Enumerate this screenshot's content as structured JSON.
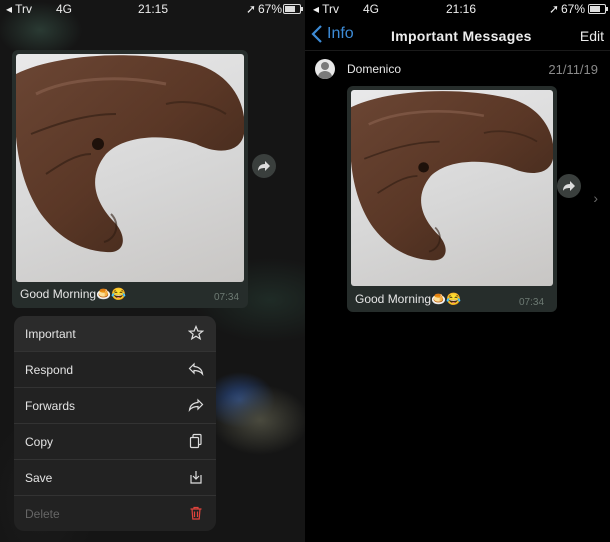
{
  "left": {
    "status": {
      "carrier": "Trv",
      "network": "4G",
      "time": "21:15",
      "battery": "67%"
    },
    "message": {
      "caption": "Good Morning",
      "emoji": "🍮😂",
      "time": "07:34"
    },
    "menu": [
      {
        "label": "Important",
        "icon": "star-icon"
      },
      {
        "label": "Respond",
        "icon": "reply-icon"
      },
      {
        "label": "Forwards",
        "icon": "forward-icon"
      },
      {
        "label": "Copy",
        "icon": "copy-icon"
      },
      {
        "label": "Save",
        "icon": "save-icon"
      },
      {
        "label": "Delete",
        "icon": "trash-icon"
      }
    ],
    "colors": {
      "delete_icon": "#e0443d"
    }
  },
  "right": {
    "status": {
      "carrier": "Trv",
      "network": "4G",
      "time": "21:16",
      "battery": "67%"
    },
    "nav": {
      "back_label": "Info",
      "title": "Important Messages",
      "edit_label": "Edit"
    },
    "sender": {
      "name": "Domenico",
      "date": "21/11/19"
    },
    "message": {
      "caption": "Good Morning",
      "emoji": "🍮😂",
      "time": "07:34"
    },
    "colors": {
      "accent": "#3d8bd6"
    }
  }
}
